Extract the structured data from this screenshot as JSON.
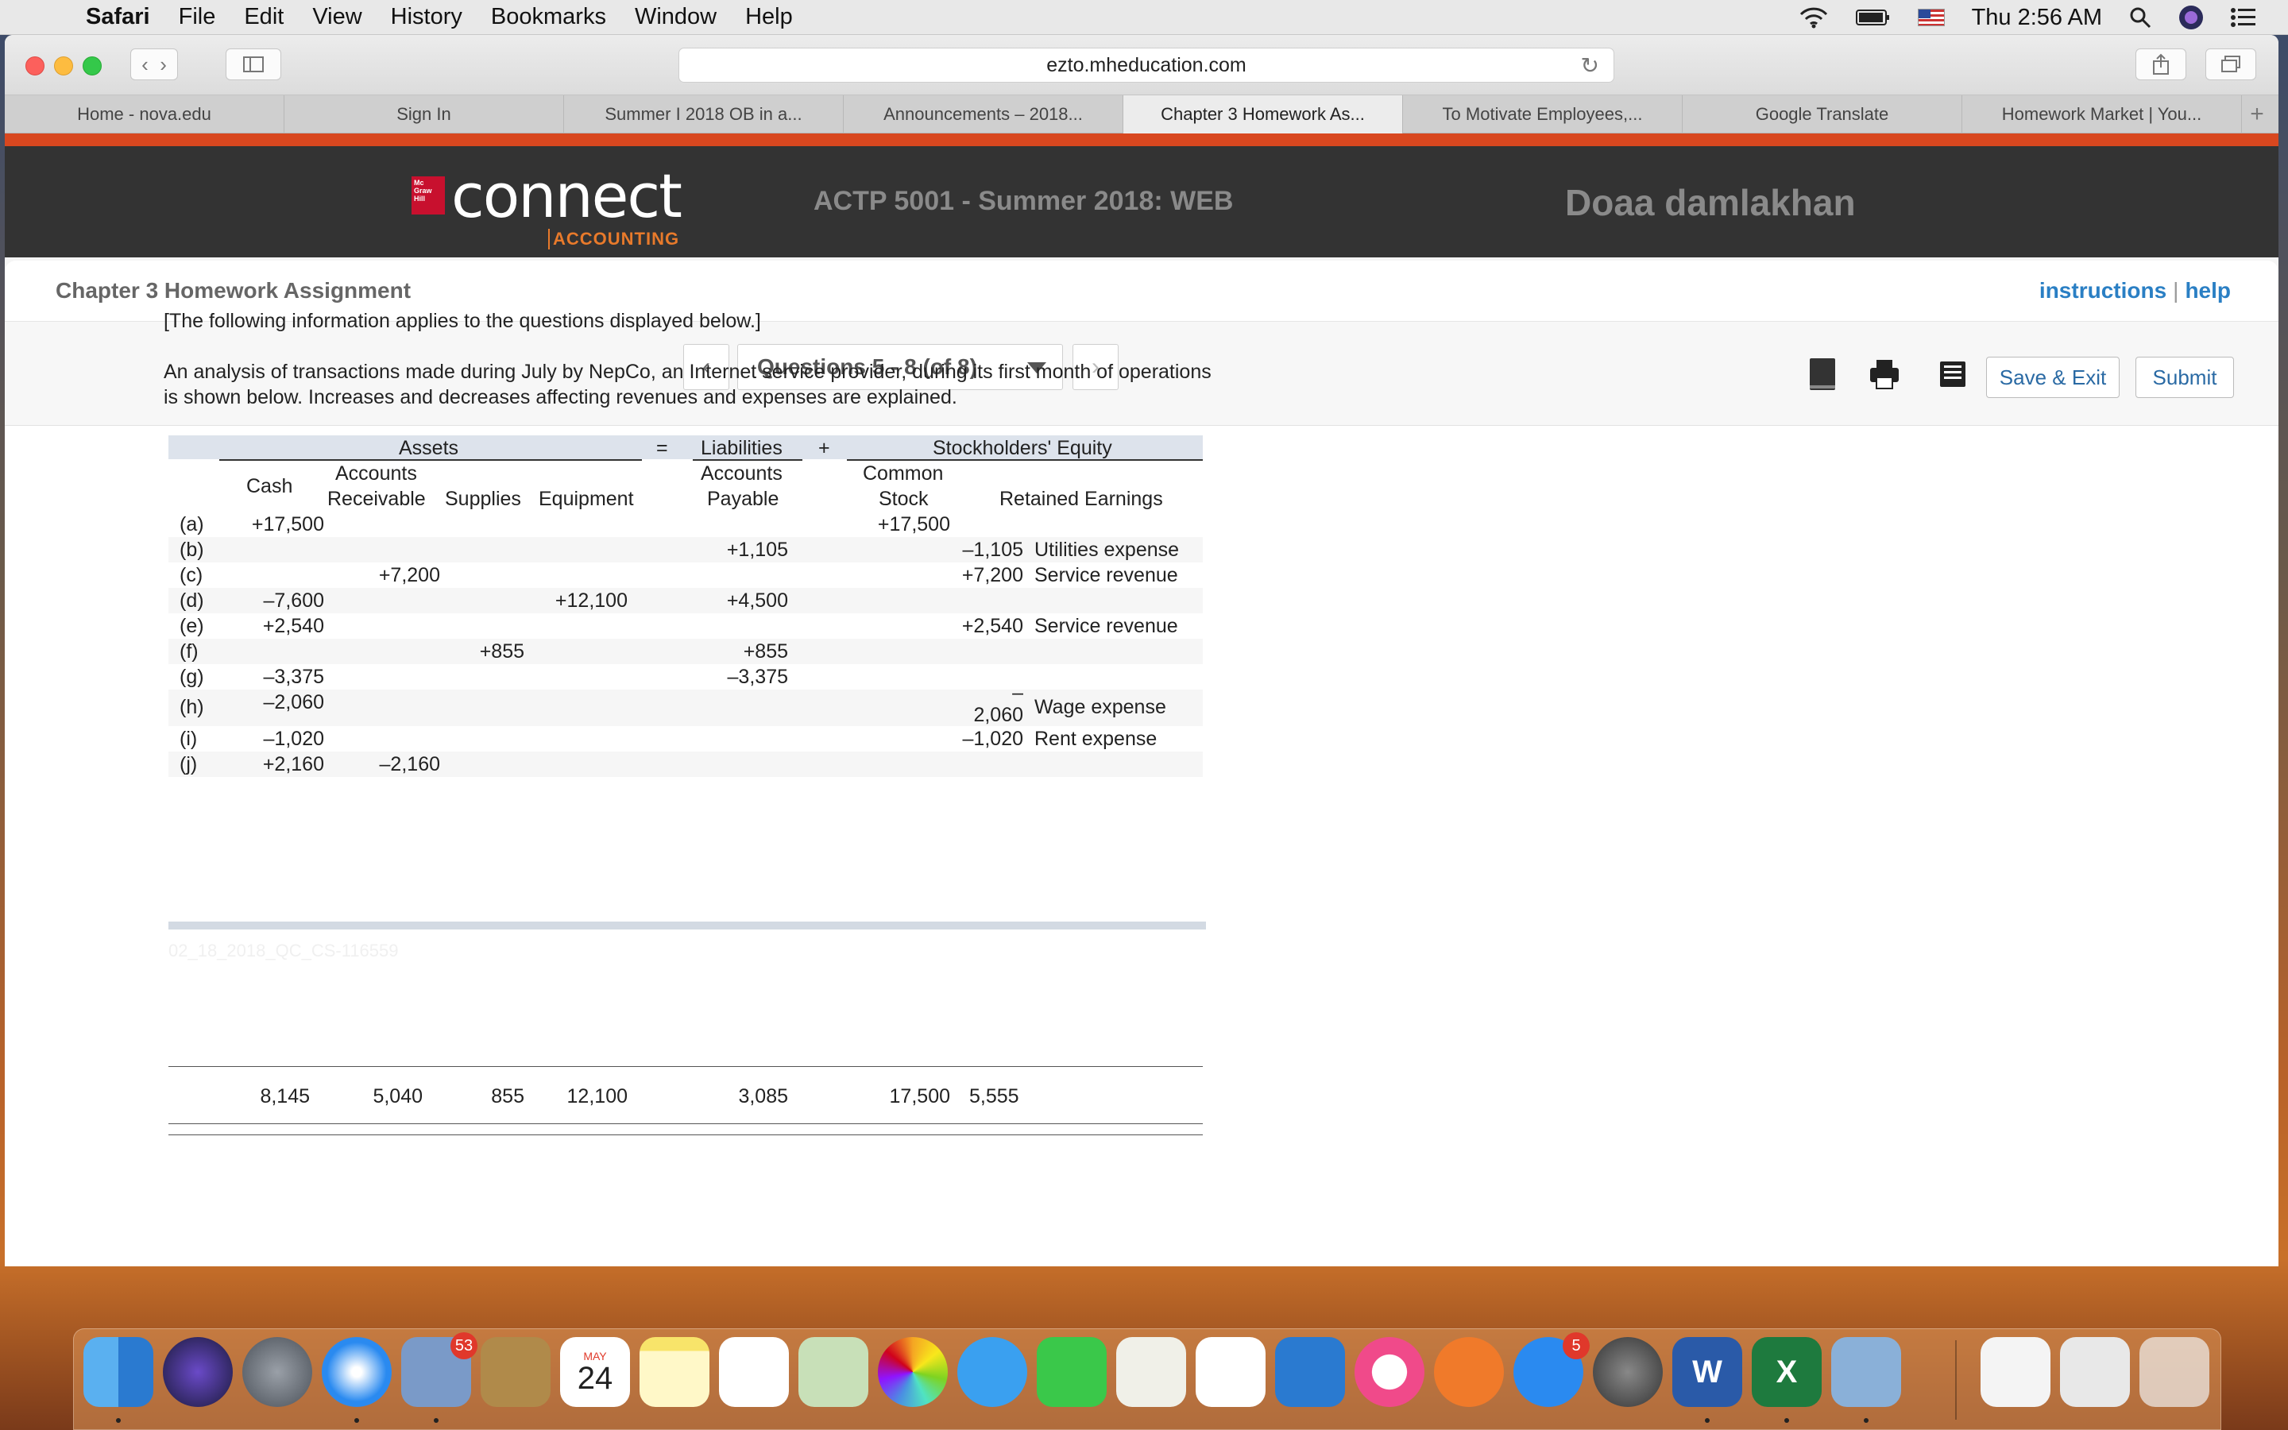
{
  "menubar": {
    "app": "Safari",
    "items": [
      "File",
      "Edit",
      "View",
      "History",
      "Bookmarks",
      "Window",
      "Help"
    ],
    "clock": "Thu 2:56 AM"
  },
  "browser": {
    "url": "ezto.mheducation.com",
    "tabs": [
      "Home - nova.edu",
      "Sign In",
      "Summer I 2018 OB in a...",
      "Announcements – 2018...",
      "Chapter 3 Homework As...",
      "To Motivate Employees,...",
      "Google Translate",
      "Homework Market | You..."
    ],
    "active_tab_index": 4
  },
  "banner": {
    "logo_word": "connect",
    "logo_sub": "ACCOUNTING",
    "course": "ACTP 5001 - Summer 2018: WEB",
    "student": "Doaa damlakhan"
  },
  "assignment": {
    "title": "Chapter 3 Homework Assignment",
    "instructions_link": "instructions",
    "help_link": "help",
    "question_selector": "Questions 5 - 8 (of 8)",
    "save_exit": "Save & Exit",
    "submit": "Submit"
  },
  "question": {
    "intro": "[The following information applies to the questions displayed below.]",
    "text": "An analysis of transactions made during July by NepCo, an Internet service provider, during its first month of operations is shown below. Increases and decreases affecting revenues and expenses are explained."
  },
  "table": {
    "group_headers": {
      "assets": "Assets",
      "eq": "=",
      "liabilities": "Liabilities",
      "plus": "+",
      "equity": "Stockholders' Equity"
    },
    "columns": {
      "cash": "Cash",
      "ar_1": "Accounts",
      "ar_2": "Receivable",
      "supplies": "Supplies",
      "equipment": "Equipment",
      "ap_1": "Accounts",
      "ap_2": "Payable",
      "cs_1": "Common",
      "cs_2": "Stock",
      "re": "Retained Earnings"
    },
    "rows": [
      {
        "label": "(a)",
        "cash": "+17,500",
        "ar": "",
        "sup": "",
        "eqp": "",
        "ap": "",
        "cs": "+17,500",
        "re": "",
        "note": ""
      },
      {
        "label": "(b)",
        "cash": "",
        "ar": "",
        "sup": "",
        "eqp": "",
        "ap": "+1,105",
        "cs": "",
        "re": "–1,105",
        "note": "Utilities expense"
      },
      {
        "label": "(c)",
        "cash": "",
        "ar": "+7,200",
        "sup": "",
        "eqp": "",
        "ap": "",
        "cs": "",
        "re": "+7,200",
        "note": "Service revenue"
      },
      {
        "label": "(d)",
        "cash": "–7,600",
        "ar": "",
        "sup": "",
        "eqp": "+12,100",
        "ap": "+4,500",
        "cs": "",
        "re": "",
        "note": ""
      },
      {
        "label": "(e)",
        "cash": "+2,540",
        "ar": "",
        "sup": "",
        "eqp": "",
        "ap": "",
        "cs": "",
        "re": "+2,540",
        "note": "Service revenue"
      },
      {
        "label": "(f)",
        "cash": "",
        "ar": "",
        "sup": "+855",
        "eqp": "",
        "ap": "+855",
        "cs": "",
        "re": "",
        "note": ""
      },
      {
        "label": "(g)",
        "cash": "–3,375",
        "ar": "",
        "sup": "",
        "eqp": "",
        "ap": "–3,375",
        "cs": "",
        "re": "",
        "note": ""
      },
      {
        "label": "(h)",
        "cash": "–2,060",
        "ar": "",
        "sup": "",
        "eqp": "",
        "ap": "",
        "cs": "",
        "re": "–",
        "re2": "2,060",
        "note": "Wage expense"
      },
      {
        "label": "(i)",
        "cash": "–1,020",
        "ar": "",
        "sup": "",
        "eqp": "",
        "ap": "",
        "cs": "",
        "re": "–1,020",
        "note": "Rent expense"
      },
      {
        "label": "(j)",
        "cash": "+2,160",
        "ar": "–2,160",
        "sup": "",
        "eqp": "",
        "ap": "",
        "cs": "",
        "re": "",
        "note": ""
      }
    ],
    "totals": {
      "cash": "8,145",
      "ar": "5,040",
      "sup": "855",
      "eqp": "12,100",
      "ap": "3,085",
      "cs": "17,500",
      "re": "5,555"
    }
  },
  "footer_code": "02_18_2018_QC_CS-116559",
  "dock": {
    "mail_badge": "53",
    "calendar_month": "MAY",
    "calendar_day": "24",
    "appstore_badge": "5"
  }
}
